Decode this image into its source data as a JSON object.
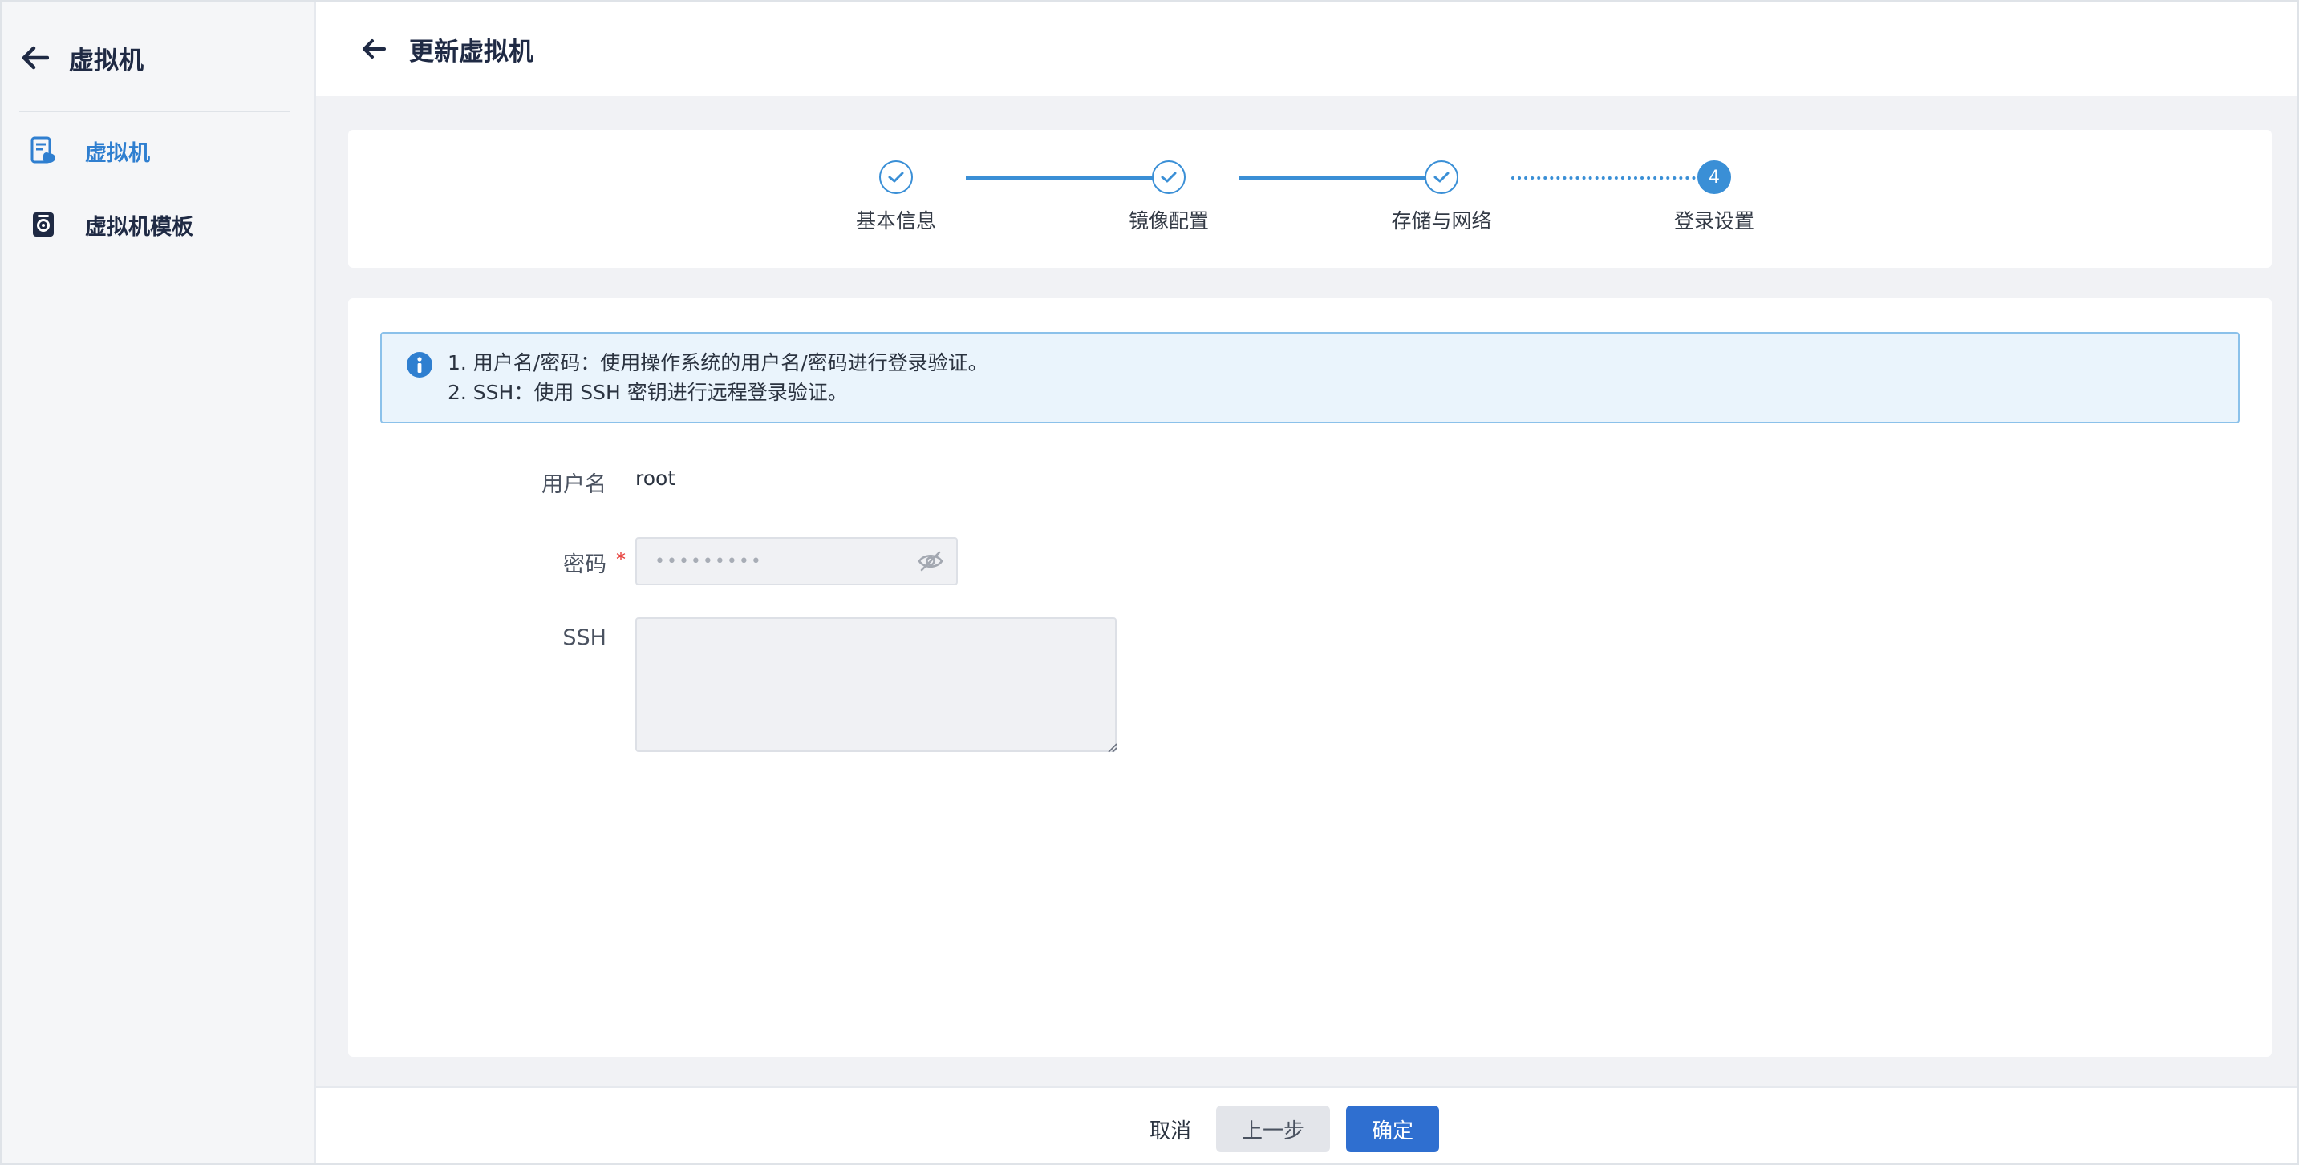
{
  "sidebar": {
    "title": "虚拟机",
    "items": [
      {
        "label": "虚拟机",
        "icon": "vm-icon",
        "active": true
      },
      {
        "label": "虚拟机模板",
        "icon": "vm-template-icon",
        "active": false
      }
    ]
  },
  "header": {
    "title": "更新虚拟机"
  },
  "steps": [
    {
      "label": "基本信息",
      "status": "done"
    },
    {
      "label": "镜像配置",
      "status": "done"
    },
    {
      "label": "存储与网络",
      "status": "done"
    },
    {
      "label": "登录设置",
      "number": "4",
      "status": "current"
    }
  ],
  "info": {
    "line1": "1. 用户名/密码：使用操作系统的用户名/密码进行登录验证。",
    "line2": "2. SSH：使用 SSH 密钥进行远程登录验证。"
  },
  "form": {
    "username_label": "用户名",
    "username_value": "root",
    "password_label": "密码",
    "password_mask": "•••••••••",
    "required_mark": "*",
    "ssh_label": "SSH",
    "ssh_value": ""
  },
  "footer": {
    "cancel": "取消",
    "prev": "上一步",
    "confirm": "确定"
  },
  "colors": {
    "accent": "#3a8fd6",
    "primary_button": "#2f6fd0",
    "active_nav": "#2f7fd0",
    "info_bg": "#eaf4fc",
    "required": "#e53935"
  }
}
